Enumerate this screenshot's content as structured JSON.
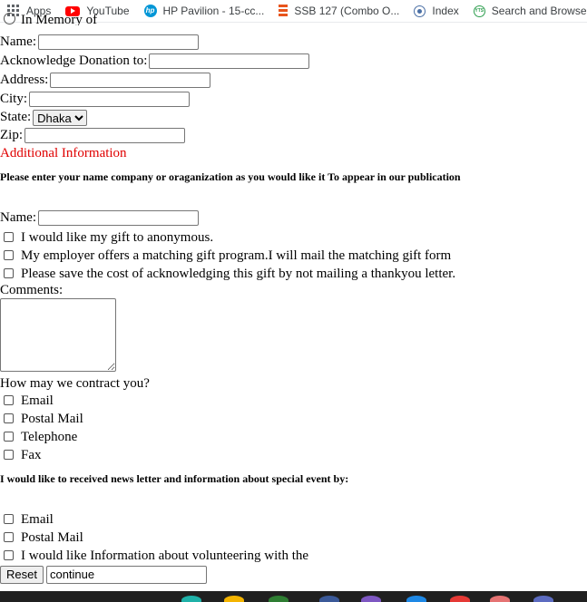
{
  "bookmarks": [
    {
      "label": "Apps",
      "icon": "apps-grid-icon"
    },
    {
      "label": "YouTube",
      "icon": "youtube-icon"
    },
    {
      "label": "HP Pavilion - 15-cc...",
      "icon": "hp-icon"
    },
    {
      "label": "SSB 127 (Combo O...",
      "icon": "ssb-icon"
    },
    {
      "label": "Index",
      "icon": "index-icon"
    },
    {
      "label": "Search and Browse",
      "icon": "yts-icon"
    }
  ],
  "form": {
    "memory_label": "In Memory of",
    "name_label": "Name:",
    "ack_label": "Acknowledge Donation to:",
    "address_label": "Address:",
    "city_label": "City:",
    "state_label": "State:",
    "state_value": "Dhaka",
    "zip_label": "Zip:",
    "additional_heading": "Additional Information",
    "publication_note": "Please enter your name company or oraganization as you would like it To appear in our publication",
    "name2_label": "Name:",
    "anonymous_label": "I would like my gift to anonymous.",
    "employer_label": "My employer offers a matching gift program.I will mail the matching gift form",
    "save_cost_label": "Please save the cost of acknowledging this gift by not mailing a thankyou letter.",
    "comments_label": "Comments:",
    "contact_question": "How may we contract you?",
    "contact_options": [
      "Email",
      "Postal Mail",
      "Telephone",
      "Fax"
    ],
    "newsletter_note": "I would like to received news letter and information about special event by:",
    "newsletter_options": [
      "Email",
      "Postal Mail",
      "I would like Information about volunteering with the"
    ],
    "reset_label": "Reset",
    "continue_value": "continue"
  }
}
